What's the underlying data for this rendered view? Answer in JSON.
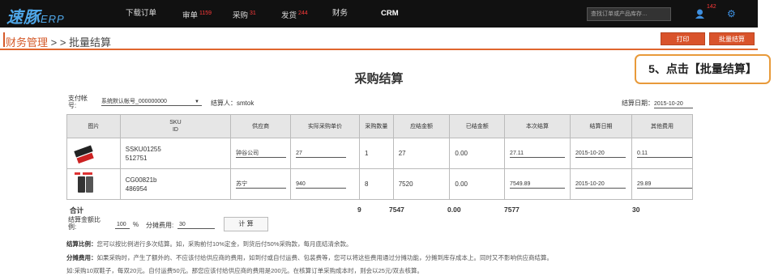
{
  "header": {
    "logo_main": "速豚",
    "logo_sub": "ERP",
    "nav": [
      {
        "label": "下载订单",
        "count": ""
      },
      {
        "label": "审单",
        "count": "1159"
      },
      {
        "label": "采购",
        "count": "31"
      },
      {
        "label": "发货",
        "count": "244"
      },
      {
        "label": "财务",
        "count": ""
      },
      {
        "label": "CRM",
        "count": ""
      }
    ],
    "search_placeholder": "查找订单或产品库存…",
    "notify_count": "142"
  },
  "breadcrumb": {
    "parent": "财务管理",
    "sep": " > > ",
    "current": "批量结算"
  },
  "actions": {
    "print_label": "打印",
    "batch_label": "批量结算"
  },
  "callout": "5、点击【批量结算】",
  "page_title": "采购结算",
  "form": {
    "account_label": "支付帐\n号:",
    "account_value": "系统默认帐号_000000000",
    "settler_label": "结算人：",
    "settler_value": "smtok",
    "date_label": "结算日期：",
    "date_value": "2015-10-20"
  },
  "table": {
    "headers": [
      "图片",
      "SKU\nID",
      "供应商",
      "实际采购单价",
      "采购数量",
      "应结金额",
      "已结金额",
      "本次结算",
      "结算日期",
      "其他费用"
    ],
    "rows": [
      {
        "sku": "SSKU01255",
        "id": "512751",
        "supplier": "钟谷公司",
        "price": "27",
        "qty": "1",
        "due": "27",
        "paid": "0.00",
        "this": "27.11",
        "date": "2015-10-20",
        "other": "0.11"
      },
      {
        "sku": "CG00821b",
        "id": "486954",
        "supplier": "苏宁",
        "price": "940",
        "qty": "8",
        "due": "7520",
        "paid": "0.00",
        "this": "7549.89",
        "date": "2015-10-20",
        "other": "29.89"
      }
    ]
  },
  "totals": {
    "label": "合计",
    "qty": "9",
    "due": "7547",
    "paid": "0.00",
    "this": "7577",
    "other": "30"
  },
  "ratio": {
    "label": "结算金额比\n例:",
    "value": "100",
    "unit": "%",
    "fee_label": "分摊费用:",
    "fee_value": "30",
    "calc_label": "计 算"
  },
  "notes": {
    "n1_title": "结算比例：",
    "n1_text": "您可以按比例进行多次结算。如，采购前付10%定金，到货后付50%采购款，每月底结清余款。",
    "n2_title": "分摊费用：",
    "n2_text": "如果采购时，产生了额外的、不应该付给供应商的费用，如到付或自付运费、包装费等，您可以将这些费用通过分摊功能，分摊到库存成本上。同时又不影响供应商结算。",
    "n3_text": "如:采购10双鞋子，每双20元。自付运费50元。那您应该付给供应商的费用是200元。在核算订单采购成本时，则会以25元/双去核算。"
  },
  "colors": {
    "accent": "#d9532b",
    "topbar": "#111111",
    "callout_border": "#e89a3a"
  }
}
